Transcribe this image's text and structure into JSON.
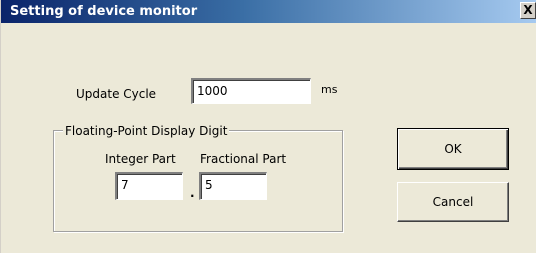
{
  "window": {
    "title": "Setting of device monitor",
    "close_label": "X"
  },
  "update_cycle": {
    "label": "Update Cycle",
    "value": "1000",
    "unit": "ms"
  },
  "floating_point": {
    "group_label": "Floating-Point Display Digit",
    "integer_label": "Integer Part",
    "integer_value": "7",
    "separator": ".",
    "fractional_label": "Fractional Part",
    "fractional_value": "5"
  },
  "buttons": {
    "ok_label": "OK",
    "cancel_label": "Cancel"
  }
}
